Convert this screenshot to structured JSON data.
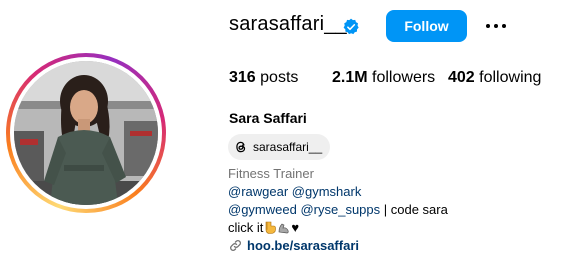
{
  "profile": {
    "username": "sarasaffari__",
    "follow_label": "Follow",
    "full_name": "Sara Saffari",
    "threads_handle": "sarasaffari__",
    "category": "Fitness Trainer"
  },
  "stats": {
    "posts_count": "316",
    "posts_label": "posts",
    "followers_count": "2.1M",
    "followers_label": "followers",
    "following_count": "402",
    "following_label": "following"
  },
  "bio": {
    "line1_mention1": "@rawgear",
    "line1_mention2": "@gymshark",
    "line2_mention1": "@gymweed",
    "line2_mention2": "@ryse_supps",
    "line2_text": " | code sara",
    "line3_text": "click it",
    "line3_heart": "♥",
    "link": "hoo.be/sarasaffari"
  },
  "colors": {
    "accent": "#0095f6",
    "link": "#00376b",
    "secondary_text": "#737373",
    "pill_bg": "#efefef",
    "verified": "#0095f6"
  },
  "icons": {
    "verified": "verified-badge-icon",
    "more": "more-options-icon",
    "threads": "threads-icon",
    "link": "link-icon"
  }
}
